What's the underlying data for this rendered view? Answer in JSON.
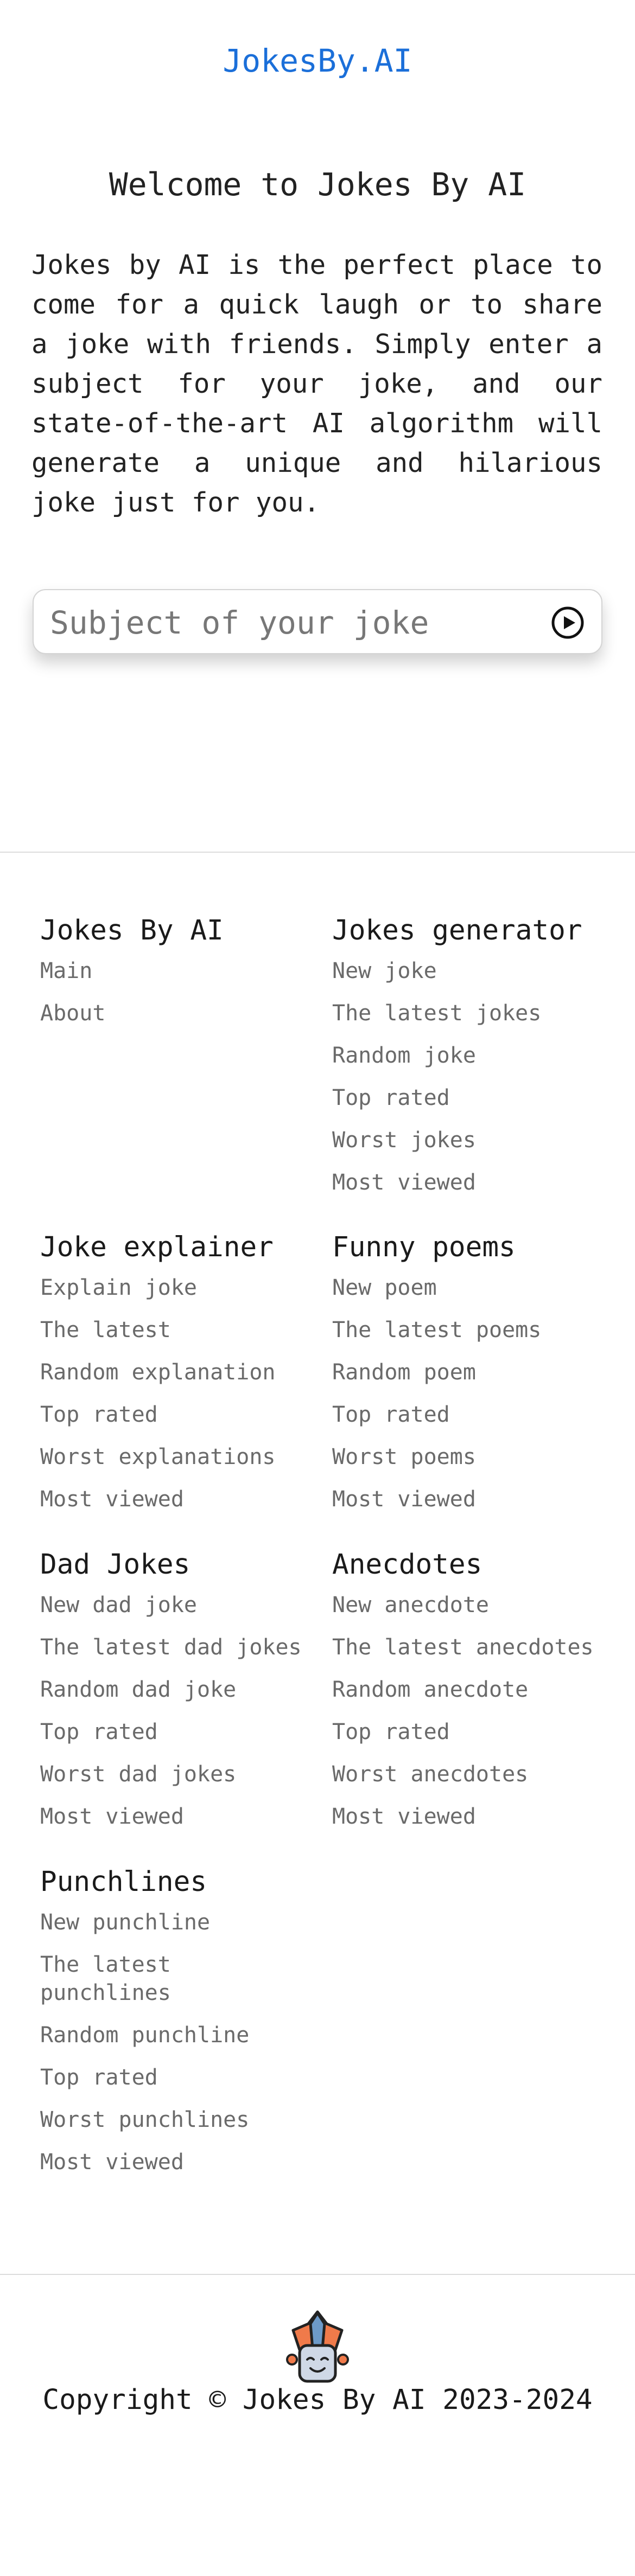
{
  "header": {
    "logo": "JokesBy.AI"
  },
  "hero": {
    "title": "Welcome to Jokes By AI",
    "description": "Jokes by AI is the perfect place to come for a quick laugh or to share a joke with friends. Simply enter a subject for your joke, and our state-of-the-art AI algorithm will generate a unique and hilarious joke just for you."
  },
  "search": {
    "placeholder": "Subject of your joke",
    "value": "",
    "submit_icon": "play-circle-icon"
  },
  "footer": {
    "sections": [
      {
        "title": "Jokes By AI",
        "links": [
          "Main",
          "About"
        ]
      },
      {
        "title": "Jokes generator",
        "links": [
          "New joke",
          "The latest jokes",
          "Random joke",
          "Top rated",
          "Worst jokes",
          "Most viewed"
        ]
      },
      {
        "title": "Joke explainer",
        "links": [
          "Explain joke",
          "The latest",
          "Random explanation",
          "Top rated",
          "Worst explanations",
          "Most viewed"
        ]
      },
      {
        "title": "Funny poems",
        "links": [
          "New poem",
          "The latest poems",
          "Random poem",
          "Top rated",
          "Worst poems",
          "Most viewed"
        ]
      },
      {
        "title": "Dad Jokes",
        "links": [
          "New dad joke",
          "The latest dad jokes",
          "Random dad joke",
          "Top rated",
          "Worst dad jokes",
          "Most viewed"
        ]
      },
      {
        "title": "Anecdotes",
        "links": [
          "New anecdote",
          "The latest anecdotes",
          "Random anecdote",
          "Top rated",
          "Worst anecdotes",
          "Most viewed"
        ]
      },
      {
        "title": "Punchlines",
        "links": [
          "New punchline",
          "The latest\npunchlines",
          "Random punchline",
          "Top rated",
          "Worst punchlines",
          "Most viewed"
        ]
      }
    ],
    "mascot_icon": "jester-icon",
    "copyright": "Copyright © Jokes By AI 2023-2024"
  },
  "colors": {
    "brand": "#1b6fd9",
    "link": "#6a6a6a",
    "mascot_orange": "#f07a4a",
    "mascot_blue": "#6d9ac8"
  }
}
